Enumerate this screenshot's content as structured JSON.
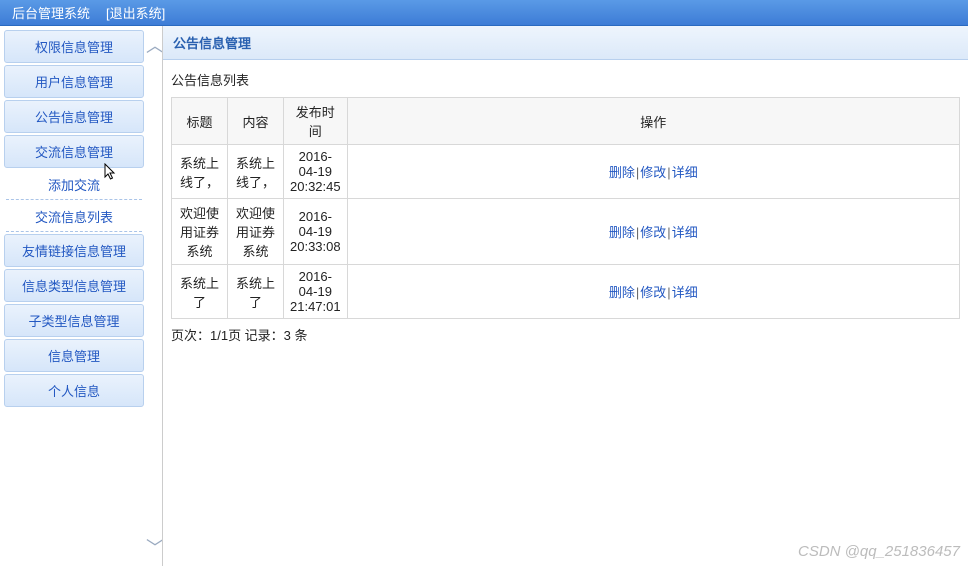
{
  "header": {
    "title": "后台管理系统",
    "logout": "[退出系统]"
  },
  "sidebar": {
    "items": [
      {
        "label": "权限信息管理"
      },
      {
        "label": "用户信息管理"
      },
      {
        "label": "公告信息管理"
      },
      {
        "label": "交流信息管理"
      }
    ],
    "subitems": [
      {
        "label": "添加交流"
      },
      {
        "label": "交流信息列表"
      }
    ],
    "items2": [
      {
        "label": "友情链接信息管理"
      },
      {
        "label": "信息类型信息管理"
      },
      {
        "label": "子类型信息管理"
      },
      {
        "label": "信息管理"
      },
      {
        "label": "个人信息"
      }
    ]
  },
  "panel": {
    "title": "公告信息管理",
    "list_title": "公告信息列表",
    "columns": {
      "title": "标题",
      "content": "内容",
      "time": "发布时间",
      "action": "操作"
    },
    "rows": [
      {
        "title": "系统上线了，",
        "content": "系统上线了，",
        "time": "2016-04-19 20:32:45"
      },
      {
        "title": "欢迎使用证券系统",
        "content": "欢迎使用证券系统",
        "time": "2016-04-19 20:33:08"
      },
      {
        "title": "系统上了",
        "content": "系统上了",
        "time": "2016-04-19 21:47:01"
      }
    ],
    "actions": {
      "delete": "删除",
      "edit": "修改",
      "detail": "详细"
    },
    "pager": "页次：1/1页 记录：3 条"
  },
  "watermark": "CSDN @qq_251836457"
}
